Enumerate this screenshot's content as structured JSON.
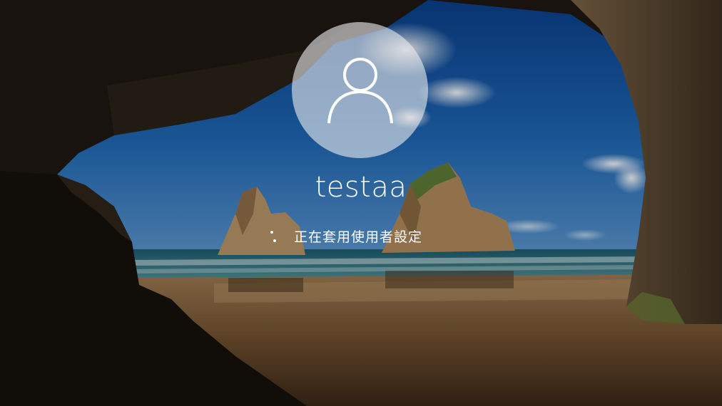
{
  "user": {
    "name": "testaa",
    "avatar_icon": "user-icon"
  },
  "status": {
    "text": "正在套用使用者設定",
    "spinner_icon": "loading-spinner-icon"
  },
  "colors": {
    "text": "#ffffff",
    "avatar_bg": "#e6e8ec"
  }
}
